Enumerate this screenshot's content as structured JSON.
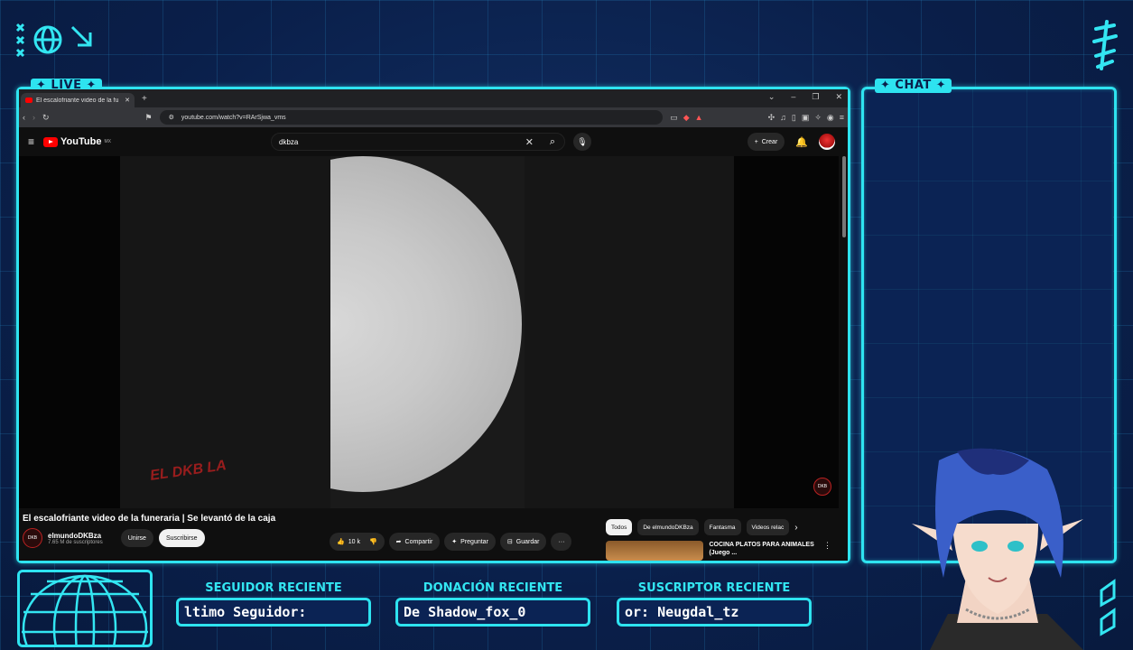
{
  "overlay": {
    "live_tag": "LIVE",
    "chat_tag": "CHAT",
    "stats": [
      {
        "label": "SEGUIDOR RECIENTE",
        "value": "ltimo Seguidor:"
      },
      {
        "label": "DONACIÓN RECIENTE",
        "value": "De Shadow_fox_0"
      },
      {
        "label": "SUSCRIPTOR RECIENTE",
        "value": "or: Neugdal_tz"
      }
    ],
    "colors": {
      "accent": "#2ee3f0",
      "background": "#0a1f4a"
    }
  },
  "browser": {
    "tab_title": "El escalofriante video de la fu",
    "url": "youtube.com/watch?v=RArSjwa_vms",
    "window_controls": [
      "⌄",
      "–",
      "❐",
      "✕"
    ]
  },
  "youtube": {
    "logo": "YouTube",
    "country": "MX",
    "search_value": "dkbza",
    "create_label": "Crear",
    "video_title": "El escalofriante video de la funeraria | Se levantó de la caja",
    "channel_name": "elmundoDKBza",
    "subscribers": "7.65 M de suscriptores",
    "join_label": "Unirse",
    "subscribe_label": "Suscribirse",
    "likes": "10 k",
    "share_label": "Compartir",
    "ask_label": "Preguntar",
    "save_label": "Guardar",
    "chips": [
      "Todos",
      "De elmundoDKBza",
      "Fantasma",
      "Videos relac"
    ],
    "recommended": {
      "title": "COCINA PLATOS PARA ANIMALES (Juego ..."
    },
    "watermark": "DKB",
    "watermark_big": "EL DKB LA"
  }
}
